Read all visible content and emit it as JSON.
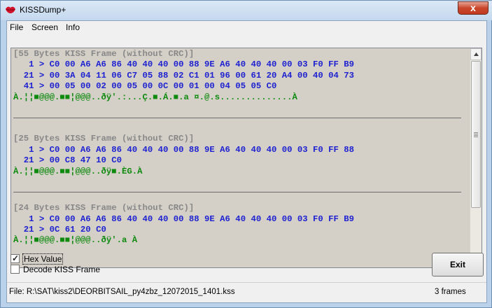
{
  "window": {
    "title": "KISSDump+",
    "close_glyph": "x"
  },
  "menu": [
    "File",
    "Screen",
    "Info"
  ],
  "frames": [
    {
      "header": "[55 Bytes KISS Frame (without CRC)]",
      "hex_lines": [
        "   1 > C0 00 A6 A6 86 40 40 40 00 88 9E A6 40 40 40 00 03 F0 FF B9",
        "  21 > 00 3A 04 11 06 C7 05 88 02 C1 01 96 00 61 20 A4 00 40 04 73",
        "  41 > 00 05 00 02 00 05 00 0C 00 01 00 04 05 05 C0"
      ],
      "ascii": "À.¦¦■@@@.■■¦@@@..ðÿ'.:...Ç.■.Á.■.a ¤.@.s..............À"
    },
    {
      "header": "[25 Bytes KISS Frame (without CRC)]",
      "hex_lines": [
        "   1 > C0 00 A6 A6 86 40 40 40 00 88 9E A6 40 40 40 00 03 F0 FF 88",
        "  21 > 00 C8 47 10 C0"
      ],
      "ascii": "À.¦¦■@@@.■■¦@@@..ðÿ■.ÈG.À"
    },
    {
      "header": "[24 Bytes KISS Frame (without CRC)]",
      "hex_lines": [
        "   1 > C0 00 A6 A6 86 40 40 40 00 88 9E A6 40 40 40 00 03 F0 FF B9",
        "  21 > 0C 61 20 C0"
      ],
      "ascii": "À.¦¦■@@@.■■¦@@@..ðÿ'.a À"
    }
  ],
  "options": {
    "hex_value": {
      "label": "Hex Value",
      "checked": true
    },
    "decode_kiss": {
      "label": "Decode KISS Frame",
      "checked": false
    }
  },
  "exit_label": "Exit",
  "status": {
    "file": "File: R:\\SAT\\kiss2\\DEORBITSAIL_py4zbz_12072015_1401.kss",
    "frames": "3 frames"
  },
  "colors": {
    "header": "#888888",
    "hex": "#1e22d0",
    "ascii": "#0e8a0e",
    "background": "#d4d0c8"
  },
  "icons": {
    "app": "lips-icon",
    "check": "checkmark-icon"
  }
}
